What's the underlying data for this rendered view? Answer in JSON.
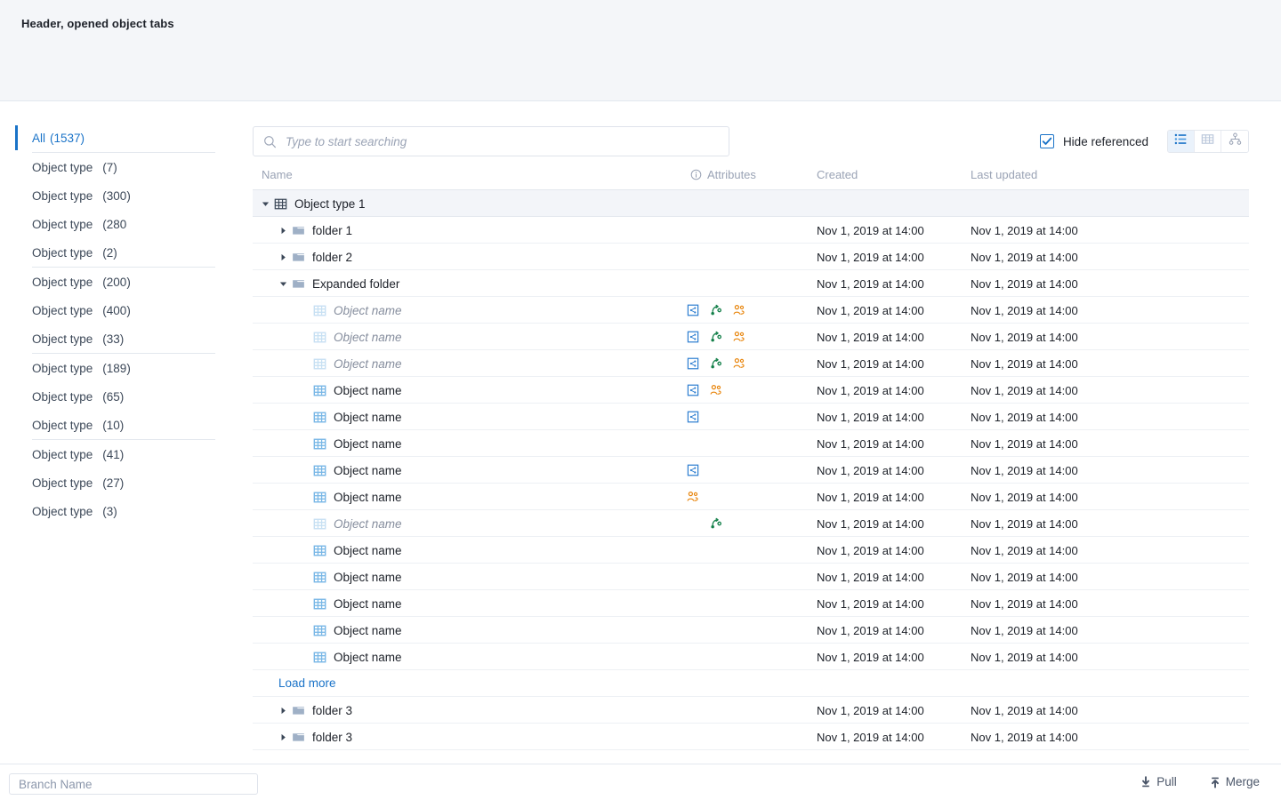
{
  "header": {
    "title": "Header, opened object tabs"
  },
  "sidebar": {
    "items": [
      {
        "label": "All",
        "count": "(1537)",
        "active": true,
        "sep_after": false
      },
      {
        "label": "Object type",
        "count": "(7)",
        "active": false,
        "sep_after": false
      },
      {
        "label": "Object type",
        "count": "(300)",
        "active": false,
        "sep_after": false
      },
      {
        "label": "Object type",
        "count": "(280",
        "active": false,
        "sep_after": false
      },
      {
        "label": "Object type",
        "count": "(2)",
        "active": false,
        "sep_after": true
      },
      {
        "label": "Object type",
        "count": "(200)",
        "active": false,
        "sep_after": false
      },
      {
        "label": "Object type",
        "count": "(400)",
        "active": false,
        "sep_after": false
      },
      {
        "label": "Object type",
        "count": "(33)",
        "active": false,
        "sep_after": true
      },
      {
        "label": "Object type",
        "count": "(189)",
        "active": false,
        "sep_after": false
      },
      {
        "label": "Object type",
        "count": "(65)",
        "active": false,
        "sep_after": false
      },
      {
        "label": "Object type",
        "count": "(10)",
        "active": false,
        "sep_after": true
      },
      {
        "label": "Object type",
        "count": "(41)",
        "active": false,
        "sep_after": false
      },
      {
        "label": "Object type",
        "count": "(27)",
        "active": false,
        "sep_after": false
      },
      {
        "label": "Object type",
        "count": "(3)",
        "active": false,
        "sep_after": false
      }
    ]
  },
  "search": {
    "placeholder": "Type to start searching",
    "value": "",
    "icon": "search-icon"
  },
  "toolbar": {
    "hide_referenced_label": "Hide referenced",
    "hide_referenced_checked": true,
    "views": [
      {
        "name": "list-view-icon",
        "active": true
      },
      {
        "name": "grid-view-icon",
        "active": false
      },
      {
        "name": "tree-view-icon",
        "active": false
      }
    ]
  },
  "table": {
    "columns": {
      "name": "Name",
      "attributes": "Attributes",
      "attributes_icon": "info-icon",
      "created": "Created",
      "last_updated": "Last updated"
    },
    "rows": [
      {
        "kind": "group",
        "level": "group",
        "caret": "down",
        "icon": "table-icon-dark",
        "name": "Object type 1",
        "attrs": [],
        "created": "",
        "updated": "",
        "referenced": false
      },
      {
        "kind": "folder",
        "level": "folder",
        "caret": "right",
        "icon": "folder-icon",
        "name": "folder 1",
        "attrs": [],
        "created": "Nov 1, 2019 at 14:00",
        "updated": "Nov 1, 2019 at 14:00",
        "referenced": false
      },
      {
        "kind": "folder",
        "level": "folder",
        "caret": "right",
        "icon": "folder-icon",
        "name": "folder 2",
        "attrs": [],
        "created": "Nov 1, 2019 at 14:00",
        "updated": "Nov 1, 2019 at 14:00",
        "referenced": false
      },
      {
        "kind": "folder",
        "level": "folder",
        "caret": "down",
        "icon": "folder-icon",
        "name": "Expanded folder",
        "attrs": [],
        "created": "Nov 1, 2019 at 14:00",
        "updated": "Nov 1, 2019 at 14:00",
        "referenced": false
      },
      {
        "kind": "object",
        "level": "obj",
        "caret": "none",
        "icon": "table-icon-light",
        "name": "Object name",
        "attrs": [
          "shared",
          "branch",
          "users"
        ],
        "created": "Nov 1, 2019 at 14:00",
        "updated": "Nov 1, 2019 at 14:00",
        "referenced": true
      },
      {
        "kind": "object",
        "level": "obj",
        "caret": "none",
        "icon": "table-icon-light",
        "name": "Object name",
        "attrs": [
          "shared",
          "branch",
          "users"
        ],
        "created": "Nov 1, 2019 at 14:00",
        "updated": "Nov 1, 2019 at 14:00",
        "referenced": true
      },
      {
        "kind": "object",
        "level": "obj",
        "caret": "none",
        "icon": "table-icon-light",
        "name": "Object name",
        "attrs": [
          "shared",
          "branch",
          "users"
        ],
        "created": "Nov 1, 2019 at 14:00",
        "updated": "Nov 1, 2019 at 14:00",
        "referenced": true
      },
      {
        "kind": "object",
        "level": "obj",
        "caret": "none",
        "icon": "table-icon",
        "name": "Object name",
        "attrs": [
          "shared",
          "users"
        ],
        "created": "Nov 1, 2019 at 14:00",
        "updated": "Nov 1, 2019 at 14:00",
        "referenced": false
      },
      {
        "kind": "object",
        "level": "obj",
        "caret": "none",
        "icon": "table-icon",
        "name": "Object name",
        "attrs": [
          "shared"
        ],
        "created": "Nov 1, 2019 at 14:00",
        "updated": "Nov 1, 2019 at 14:00",
        "referenced": false
      },
      {
        "kind": "object",
        "level": "obj",
        "caret": "none",
        "icon": "table-icon",
        "name": "Object name",
        "attrs": [],
        "created": "Nov 1, 2019 at 14:00",
        "updated": "Nov 1, 2019 at 14:00",
        "referenced": false
      },
      {
        "kind": "object",
        "level": "obj",
        "caret": "none",
        "icon": "table-icon",
        "name": "Object name",
        "attrs": [
          "shared"
        ],
        "created": "Nov 1, 2019 at 14:00",
        "updated": "Nov 1, 2019 at 14:00",
        "referenced": false
      },
      {
        "kind": "object",
        "level": "obj",
        "caret": "none",
        "icon": "table-icon",
        "name": "Object name",
        "attrs": [
          "users"
        ],
        "created": "Nov 1, 2019 at 14:00",
        "updated": "Nov 1, 2019 at 14:00",
        "referenced": false
      },
      {
        "kind": "object",
        "level": "obj",
        "caret": "none",
        "icon": "table-icon-light",
        "name": "Object name",
        "attrs": [
          "",
          "branch"
        ],
        "created": "Nov 1, 2019 at 14:00",
        "updated": "Nov 1, 2019 at 14:00",
        "referenced": true
      },
      {
        "kind": "object",
        "level": "obj",
        "caret": "none",
        "icon": "table-icon",
        "name": "Object name",
        "attrs": [],
        "created": "Nov 1, 2019 at 14:00",
        "updated": "Nov 1, 2019 at 14:00",
        "referenced": false
      },
      {
        "kind": "object",
        "level": "obj",
        "caret": "none",
        "icon": "table-icon",
        "name": "Object name",
        "attrs": [],
        "created": "Nov 1, 2019 at 14:00",
        "updated": "Nov 1, 2019 at 14:00",
        "referenced": false
      },
      {
        "kind": "object",
        "level": "obj",
        "caret": "none",
        "icon": "table-icon",
        "name": "Object name",
        "attrs": [],
        "created": "Nov 1, 2019 at 14:00",
        "updated": "Nov 1, 2019 at 14:00",
        "referenced": false
      },
      {
        "kind": "object",
        "level": "obj",
        "caret": "none",
        "icon": "table-icon",
        "name": "Object name",
        "attrs": [],
        "created": "Nov 1, 2019 at 14:00",
        "updated": "Nov 1, 2019 at 14:00",
        "referenced": false
      },
      {
        "kind": "object",
        "level": "obj",
        "caret": "none",
        "icon": "table-icon",
        "name": "Object name",
        "attrs": [],
        "created": "Nov 1, 2019 at 14:00",
        "updated": "Nov 1, 2019 at 14:00",
        "referenced": false
      },
      {
        "kind": "loadmore",
        "level": "obj",
        "caret": "none",
        "icon": "",
        "name": "Load more",
        "attrs": [],
        "created": "",
        "updated": "",
        "referenced": false
      },
      {
        "kind": "folder",
        "level": "folder",
        "caret": "right",
        "icon": "folder-icon",
        "name": "folder 3",
        "attrs": [],
        "created": "Nov 1, 2019 at 14:00",
        "updated": "Nov 1, 2019 at 14:00",
        "referenced": false
      },
      {
        "kind": "folder",
        "level": "folder",
        "caret": "right",
        "icon": "folder-icon",
        "name": "folder 3",
        "attrs": [],
        "created": "Nov 1, 2019 at 14:00",
        "updated": "Nov 1, 2019 at 14:00",
        "referenced": false
      }
    ]
  },
  "bottom": {
    "branch_placeholder": "Branch Name",
    "branch_value": "",
    "pull_label": "Pull",
    "merge_label": "Merge"
  },
  "colors": {
    "accent": "#1a73c8",
    "header_bg": "#f4f6f9",
    "group_row_bg": "#f3f5f9",
    "attr_shared": "#2f7fd1",
    "attr_branch": "#1b7f4e",
    "attr_users": "#e8850c",
    "muted_text": "#9aa3b5"
  }
}
